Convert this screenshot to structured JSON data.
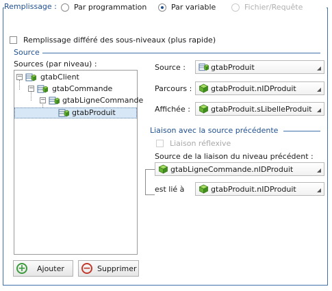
{
  "filling": {
    "title": "Remplissage :",
    "options": [
      {
        "label": "Par programmation",
        "checked": false,
        "enabled": true
      },
      {
        "label": "Par variable",
        "checked": true,
        "enabled": true
      },
      {
        "label": "Fichier/Requête",
        "checked": false,
        "enabled": false
      }
    ],
    "deferred_label": "Remplissage différé des sous-niveaux (plus rapide)"
  },
  "source_section": {
    "title": "Source",
    "tree_label": "Sources (par niveau) :",
    "tree": [
      {
        "label": "gtabClient",
        "expander": "−"
      },
      {
        "label": "gtabCommande",
        "expander": "−"
      },
      {
        "label": "gtabLigneCommande",
        "expander": "−"
      },
      {
        "label": "gtabProduit",
        "expander": ""
      }
    ],
    "fields": {
      "source_label": "Source :",
      "source_value": "gtabProduit",
      "parcours_label": "Parcours :",
      "parcours_value": "gtabProduit.nIDProduit",
      "affichee_label": "Affichée :",
      "affichee_value": "gtabProduit.sLibelleProduit"
    }
  },
  "link_section": {
    "title": "Liaison avec la source précédente",
    "reflexive_label": "Liaison réflexive",
    "prev_source_label": "Source de la liaison du niveau précédent :",
    "prev_source_value": "gtabLigneCommande.nIDProduit",
    "linked_label": "est lié à",
    "linked_value": "gtabProduit.nIDProduit"
  },
  "buttons": {
    "add": "Ajouter",
    "remove": "Supprimer"
  },
  "colors": {
    "accent": "#1f4f8f",
    "frame": "#3f6fa8",
    "add_green": "#3c9a3c",
    "remove_red": "#c0392b"
  }
}
